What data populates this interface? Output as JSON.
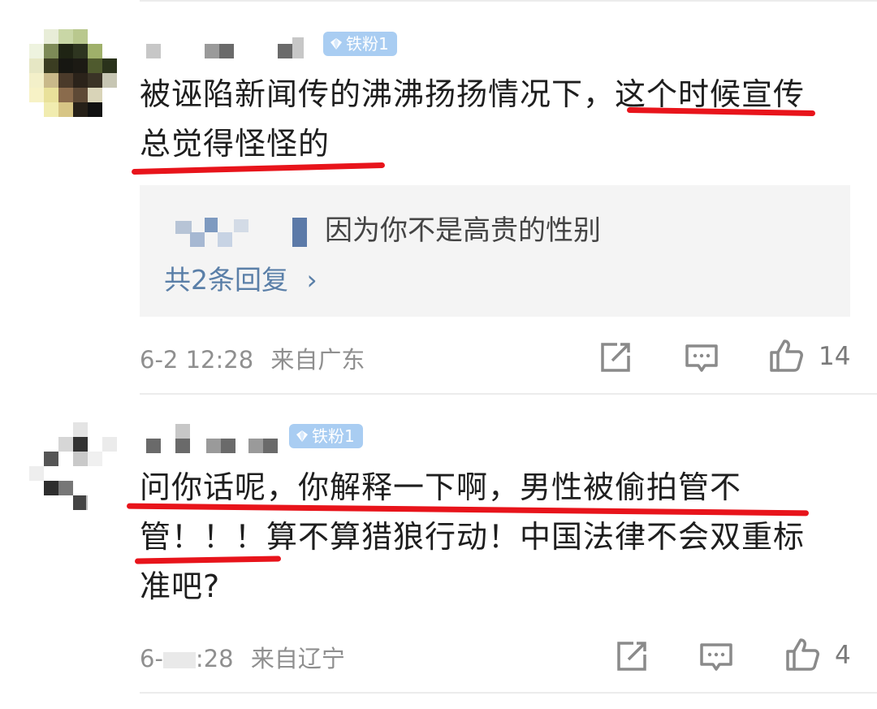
{
  "comments": [
    {
      "badge": "铁粉1",
      "text": "被诬陷新闻传的沸沸扬扬情况下，这个时候宣传总觉得怪怪的",
      "reply": {
        "text": "因为你不是高贵的性别",
        "more": "共2条回复",
        "more_arrow": "›"
      },
      "time": "6-2 12:28",
      "location": "来自广东",
      "likes": "14"
    },
    {
      "badge": "铁粉1",
      "text": "问你话呢，你解释一下啊，男性被偷拍管不管！！！算不算猎狼行动！中国法律不会双重标准吧?",
      "time": "6-",
      "time_tail": ":28",
      "location": "来自辽宁",
      "likes": "4"
    }
  ],
  "icons": {
    "share": "share-icon",
    "comment": "comment-icon",
    "like": "thumbs-up-icon",
    "badge": "diamond-icon"
  },
  "colors": {
    "underline": "#e8141b",
    "badge": "#a9cdf2",
    "link": "#5a7fa8"
  }
}
